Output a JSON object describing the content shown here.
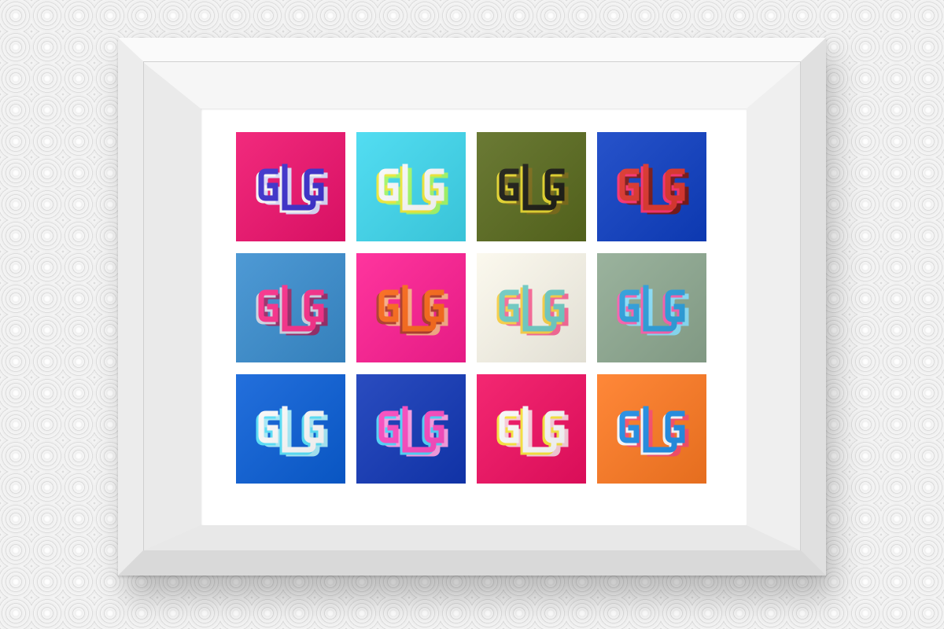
{
  "artwork": {
    "logo_text": "ɢʟɢ",
    "tiles": [
      {
        "bg": "#f0126e",
        "c1": "#3b2fd0",
        "c2": "#ffffff",
        "c3": "#e0e0ff"
      },
      {
        "bg": "#3fd9f0",
        "c1": "#ffffff",
        "c2": "#f4ef3a",
        "c3": "#a7ff6a"
      },
      {
        "bg": "#5a6b1e",
        "c1": "#1a1a12",
        "c2": "#e9d92c",
        "c3": "#7d6c18"
      },
      {
        "bg": "#0e3fc4",
        "c1": "#e0332b",
        "c2": "#ff2f72",
        "c3": "#7a1515"
      },
      {
        "bg": "#3a8ed0",
        "c1": "#ff2f8c",
        "c2": "#d6d9e8",
        "c3": "#9a2c6b"
      },
      {
        "bg": "#ff1e93",
        "c1": "#ff6a18",
        "c2": "#b23a2a",
        "c3": "#ffb088"
      },
      {
        "bg": "#fbf8ec",
        "c1": "#6fcfc7",
        "c2": "#ffd545",
        "c3": "#ff6a9a"
      },
      {
        "bg": "#8faa92",
        "c1": "#2aa0e0",
        "c2": "#ff60b0",
        "c3": "#8be3ff"
      },
      {
        "bg": "#0a5fd8",
        "c1": "#ffffff",
        "c2": "#57e5ff",
        "c3": "#aaf0ff"
      },
      {
        "bg": "#1238b8",
        "c1": "#ff49c2",
        "c2": "#4fd8ff",
        "c3": "#ffa0e8"
      },
      {
        "bg": "#f20f62",
        "c1": "#ffffff",
        "c2": "#ffe93a",
        "c3": "#ffd2e0"
      },
      {
        "bg": "#ff7a22",
        "c1": "#1f8ee8",
        "c2": "#ffffff",
        "c3": "#ff4d6b"
      }
    ]
  }
}
